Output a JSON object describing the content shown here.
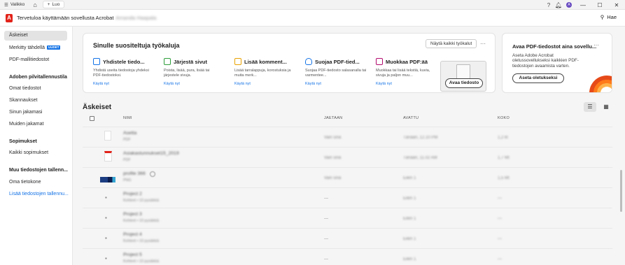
{
  "titlebar": {
    "menu_label": "Valikko",
    "new_label": "Luo"
  },
  "appbar": {
    "welcome": "Tervetuloa käyttämään sovellusta Acrobat",
    "user_name": "Amanda Haapala",
    "search_label": "Hae"
  },
  "sidebar": {
    "items_top": [
      {
        "label": "Äskeiset"
      },
      {
        "label": "Merkitty tähdellä",
        "badge": "UUDET"
      },
      {
        "label": "PDF-mallitiedostot"
      }
    ],
    "storage_heading": "Adoben pilvitallennustila",
    "storage_items": [
      "Omat tiedostot",
      "Skannaukset",
      "Sinun jakamasi",
      "Muiden jakamat"
    ],
    "agreements_heading": "Sopimukset",
    "agreements_items": [
      "Kaikki sopimukset"
    ],
    "other_heading": "Muu tiedostojen tallenn...",
    "other_items": [
      "Oma tietokone"
    ],
    "add_storage": "Lisää tiedostojen tallennu..."
  },
  "tools": {
    "title": "Sinulle suositeltuja työkaluja",
    "see_all": "Näytä kaikki työkalut",
    "use_label": "Käytä nyt",
    "open_file": "Avaa tiedosto",
    "items": [
      {
        "name": "Yhdistele tiedo...",
        "desc": "Yhdistä useita tiedostoja yhdeksi PDF-tiedostoksi.",
        "color": "#1473e6"
      },
      {
        "name": "Järjestä sivut",
        "desc": "Poista, lisää, pura, lisää tai järjestele sivuja.",
        "color": "#2d9d3a"
      },
      {
        "name": "Lisää komment...",
        "desc": "Lisää tarralappuja, korostuksia ja muita merk...",
        "color": "#e8a100"
      },
      {
        "name": "Suojaa PDF-tied...",
        "desc": "Suojaa PDF-tiedosto salasanalla tai varmentee...",
        "color": "#1473e6"
      },
      {
        "name": "Muokkaa PDF:ää",
        "desc": "Muokkaa tai lisää tekstiä, kuvia, sivuja ja paljon muu...",
        "color": "#b30b6f"
      }
    ]
  },
  "promo": {
    "title": "Avaa PDF-tiedostot aina sovellu...",
    "text": "Aseta Adobe Acrobat oletussovellukseksi kaikkien PDF-tiedostojen avaamista varten.",
    "button": "Aseta oletukseksi"
  },
  "recent": {
    "title": "Äskeiset",
    "columns": {
      "name": "NIMI",
      "shared": "JAETAAN",
      "opened": "AVATTU",
      "size": "KOKO"
    },
    "rows": [
      {
        "type": "file",
        "name": "Asetta",
        "sub": "PDF",
        "shared": "Vain sinä",
        "opened": "Tänään, 12.10 PM",
        "size": "1,2 kt"
      },
      {
        "type": "pdf",
        "name": "Asiakastunnukset15_2019",
        "sub": "PDF",
        "shared": "Vain sinä",
        "opened": "Tänään, 11.02 AM",
        "size": "1,7 Mt"
      },
      {
        "type": "image",
        "name": "profile 366",
        "sub": "PNG",
        "shared": "Vain sinä",
        "opened": "Eilen 1",
        "size": "1,5 Mt"
      },
      {
        "type": "folder",
        "name": "Project 2",
        "sub": "Kohteet • 10 pysäkkiä",
        "shared": "—",
        "opened": "Eilen 1",
        "size": "—"
      },
      {
        "type": "folder",
        "name": "Project 3",
        "sub": "Kohteet • 10 pysäkkiä",
        "shared": "—",
        "opened": "Eilen 1",
        "size": "—"
      },
      {
        "type": "folder",
        "name": "Project 4",
        "sub": "Kohteet • 10 pysäkkiä",
        "shared": "—",
        "opened": "Eilen 1",
        "size": "—"
      },
      {
        "type": "folder",
        "name": "Project 5",
        "sub": "Kohteet • 10 pysäkkiä",
        "shared": "—",
        "opened": "Eilen 1",
        "size": "—"
      }
    ]
  }
}
